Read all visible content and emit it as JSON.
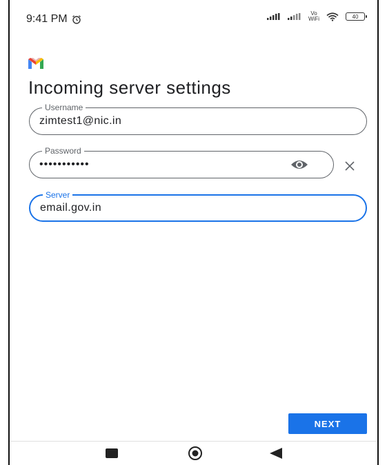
{
  "status_bar": {
    "time": "9:41 PM",
    "volte_top": "Vo",
    "volte_bottom": "WiFi",
    "battery": "40"
  },
  "header": {
    "title": "Incoming server settings"
  },
  "form": {
    "username": {
      "label": "Username",
      "value": "zimtest1@nic.in"
    },
    "password": {
      "label": "Password",
      "value": "•••••••••••"
    },
    "server": {
      "label": "Server",
      "value": "email.gov.in"
    }
  },
  "actions": {
    "next_label": "NEXT"
  },
  "colors": {
    "accent": "#1a73e8",
    "outline": "#5f6368"
  }
}
